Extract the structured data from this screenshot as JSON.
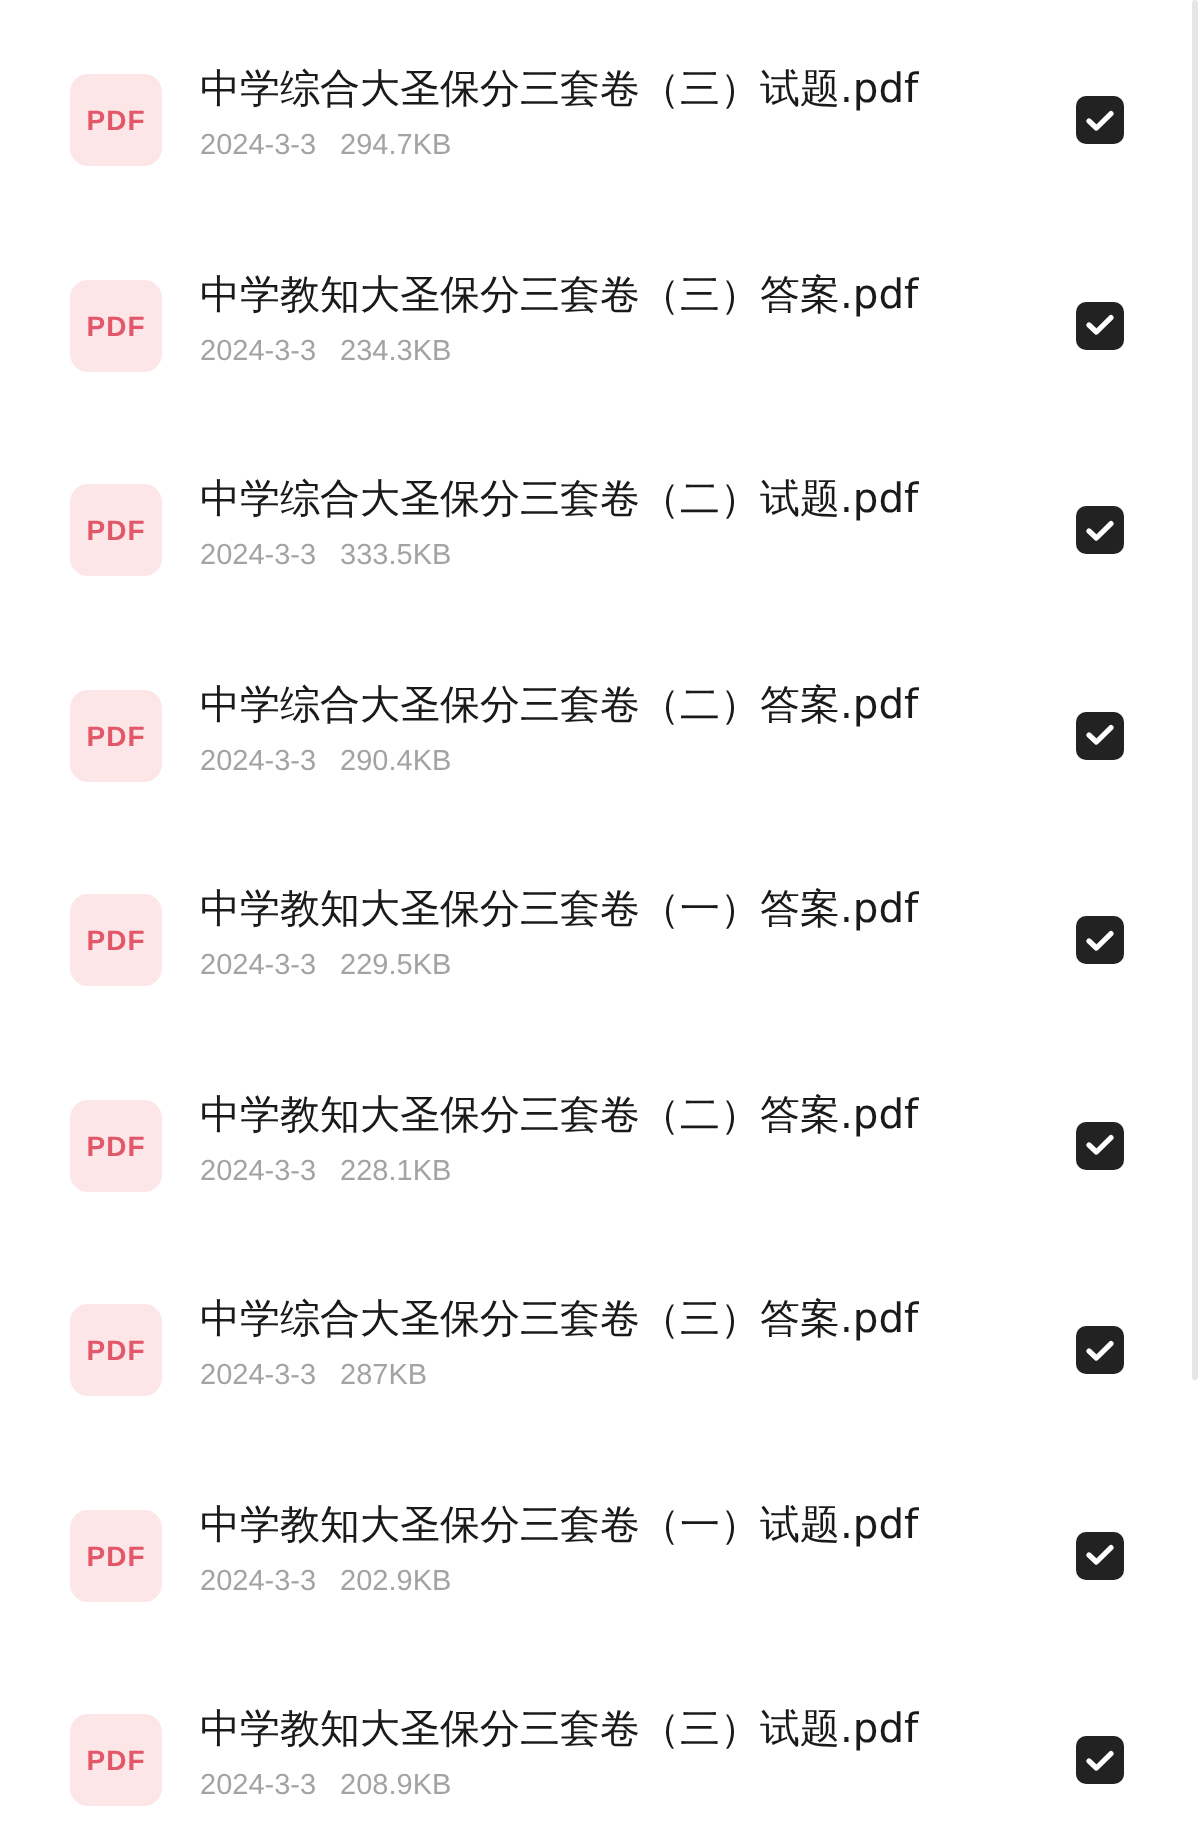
{
  "files": [
    {
      "badge": "PDF",
      "name": "中学综合大圣保分三套卷（三）试题.pdf",
      "date": "2024-3-3",
      "size": "294.7KB",
      "checked": true
    },
    {
      "badge": "PDF",
      "name": "中学教知大圣保分三套卷（三）答案.pdf",
      "date": "2024-3-3",
      "size": "234.3KB",
      "checked": true
    },
    {
      "badge": "PDF",
      "name": "中学综合大圣保分三套卷（二）试题.pdf",
      "date": "2024-3-3",
      "size": "333.5KB",
      "checked": true
    },
    {
      "badge": "PDF",
      "name": "中学综合大圣保分三套卷（二）答案.pdf",
      "date": "2024-3-3",
      "size": "290.4KB",
      "checked": true
    },
    {
      "badge": "PDF",
      "name": "中学教知大圣保分三套卷（一）答案.pdf",
      "date": "2024-3-3",
      "size": "229.5KB",
      "checked": true
    },
    {
      "badge": "PDF",
      "name": "中学教知大圣保分三套卷（二）答案.pdf",
      "date": "2024-3-3",
      "size": "228.1KB",
      "checked": true
    },
    {
      "badge": "PDF",
      "name": "中学综合大圣保分三套卷（三）答案.pdf",
      "date": "2024-3-3",
      "size": "287KB",
      "checked": true
    },
    {
      "badge": "PDF",
      "name": "中学教知大圣保分三套卷（一）试题.pdf",
      "date": "2024-3-3",
      "size": "202.9KB",
      "checked": true
    },
    {
      "badge": "PDF",
      "name": "中学教知大圣保分三套卷（三）试题.pdf",
      "date": "2024-3-3",
      "size": "208.9KB",
      "checked": true
    }
  ]
}
